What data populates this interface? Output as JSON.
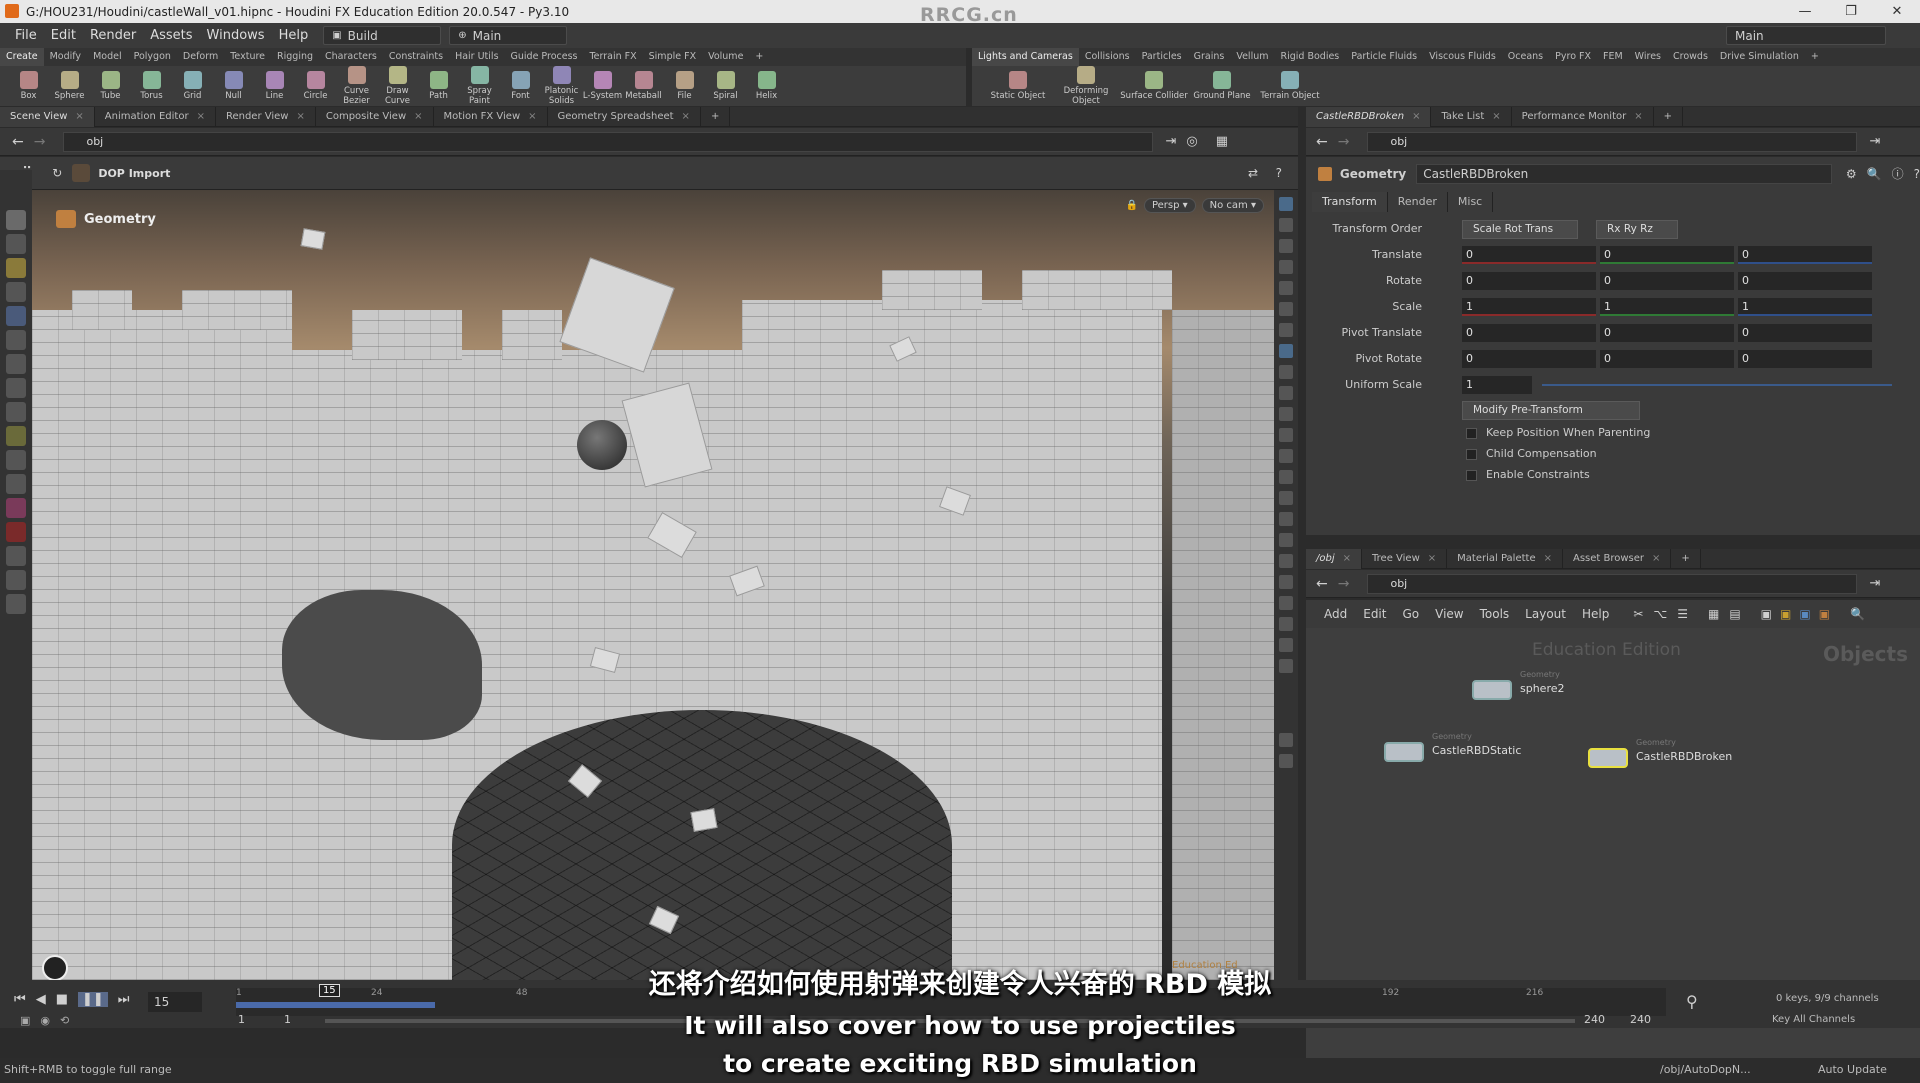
{
  "window": {
    "title": "G:/HOU231/Houdini/castleWall_v01.hipnc - Houdini FX Education Edition 20.0.547 - Py3.10",
    "watermark": "RRCG.cn",
    "controls": [
      "—",
      "❐",
      "✕"
    ]
  },
  "menubar": {
    "items": [
      "File",
      "Edit",
      "Render",
      "Assets",
      "Windows",
      "Help"
    ],
    "desktop": "Build",
    "context": "Main",
    "right_desktop": "Main"
  },
  "shelf_left": {
    "tabs": [
      "Create",
      "Modify",
      "Model",
      "Polygon",
      "Deform",
      "Texture",
      "Rigging",
      "Characters",
      "Constraints",
      "Hair Utils",
      "Guide Process",
      "Terrain FX",
      "Simple FX",
      "Volume",
      "+"
    ],
    "tools": [
      "Box",
      "Sphere",
      "Tube",
      "Torus",
      "Grid",
      "Null",
      "Line",
      "Circle",
      "Curve Bezier",
      "Draw Curve",
      "Path",
      "Spray Paint",
      "Font",
      "Platonic Solids",
      "L-System",
      "Metaball",
      "File",
      "Spiral",
      "Helix"
    ]
  },
  "shelf_right": {
    "tabs": [
      "Lights and Cameras",
      "Collisions",
      "Particles",
      "Grains",
      "Vellum",
      "Rigid Bodies",
      "Particle Fluids",
      "Viscous Fluids",
      "Oceans",
      "Pyro FX",
      "FEM",
      "Wires",
      "Crowds",
      "Drive Simulation",
      "+"
    ],
    "tools": [
      "Static Object",
      "Deforming Object",
      "Surface Collider",
      "Ground Plane",
      "Terrain Object"
    ]
  },
  "left_panel": {
    "tabs": [
      "Scene View",
      "Animation Editor",
      "Render View",
      "Composite View",
      "Motion FX View",
      "Geometry Spreadsheet",
      "+"
    ],
    "path": "obj",
    "toolbar_label": "DOP Import",
    "viewport_label": "Geometry",
    "persp": "Persp ▾",
    "cam": "No cam ▾",
    "edu_mark": "Education Ed"
  },
  "right_top_panel": {
    "tabs": [
      "CastleRBDBroken",
      "Take List",
      "Performance Monitor",
      "+"
    ],
    "path": "obj",
    "node_type": "Geometry",
    "node_name": "CastleRBDBroken",
    "param_tabs": [
      "Transform",
      "Render",
      "Misc"
    ],
    "transform_order_label": "Transform Order",
    "transform_order": "Scale Rot Trans",
    "rot_order": "Rx Ry Rz",
    "rows": [
      {
        "label": "Translate",
        "values": [
          "0",
          "0",
          "0"
        ]
      },
      {
        "label": "Rotate",
        "values": [
          "0",
          "0",
          "0"
        ]
      },
      {
        "label": "Scale",
        "values": [
          "1",
          "1",
          "1"
        ]
      },
      {
        "label": "Pivot Translate",
        "values": [
          "0",
          "0",
          "0"
        ]
      },
      {
        "label": "Pivot Rotate",
        "values": [
          "0",
          "0",
          "0"
        ]
      }
    ],
    "uniform_scale_label": "Uniform Scale",
    "uniform_scale": "1",
    "pre_transform": "Modify Pre-Transform",
    "checkboxes": [
      "Keep Position When Parenting",
      "Child Compensation",
      "Enable Constraints"
    ]
  },
  "right_bottom_panel": {
    "tabs": [
      "/obj",
      "Tree View",
      "Material Palette",
      "Asset Browser",
      "+"
    ],
    "path": "obj",
    "menu": [
      "Add",
      "Edit",
      "Go",
      "View",
      "Tools",
      "Layout",
      "Help"
    ],
    "edu_label": "Education Edition",
    "context_label": "Objects",
    "nodes": [
      {
        "type": "Geometry",
        "name": "sphere2"
      },
      {
        "type": "Geometry",
        "name": "CastleRBDStatic"
      },
      {
        "type": "Geometry",
        "name": "CastleRBDBroken"
      }
    ]
  },
  "timeline": {
    "current_frame": "15",
    "playhead": "15",
    "ticks": [
      "1",
      "24",
      "48",
      "192",
      "216"
    ],
    "start": "1",
    "start2": "1",
    "end": "240",
    "end2": "240",
    "keys_info": "0 keys, 9/9 channels",
    "key_all": "Key All Channels",
    "progress_fraction": 0.058
  },
  "status": {
    "hint": "Shift+RMB to toggle full range",
    "path": "/obj/AutoDopN...",
    "update": "Auto Update"
  },
  "subtitle": {
    "zh": "还将介绍如何使用射弹来创建令人兴奋的 RBD 模拟",
    "en1": "It will also cover how to use projectiles",
    "en2": "to create exciting RBD simulation"
  }
}
